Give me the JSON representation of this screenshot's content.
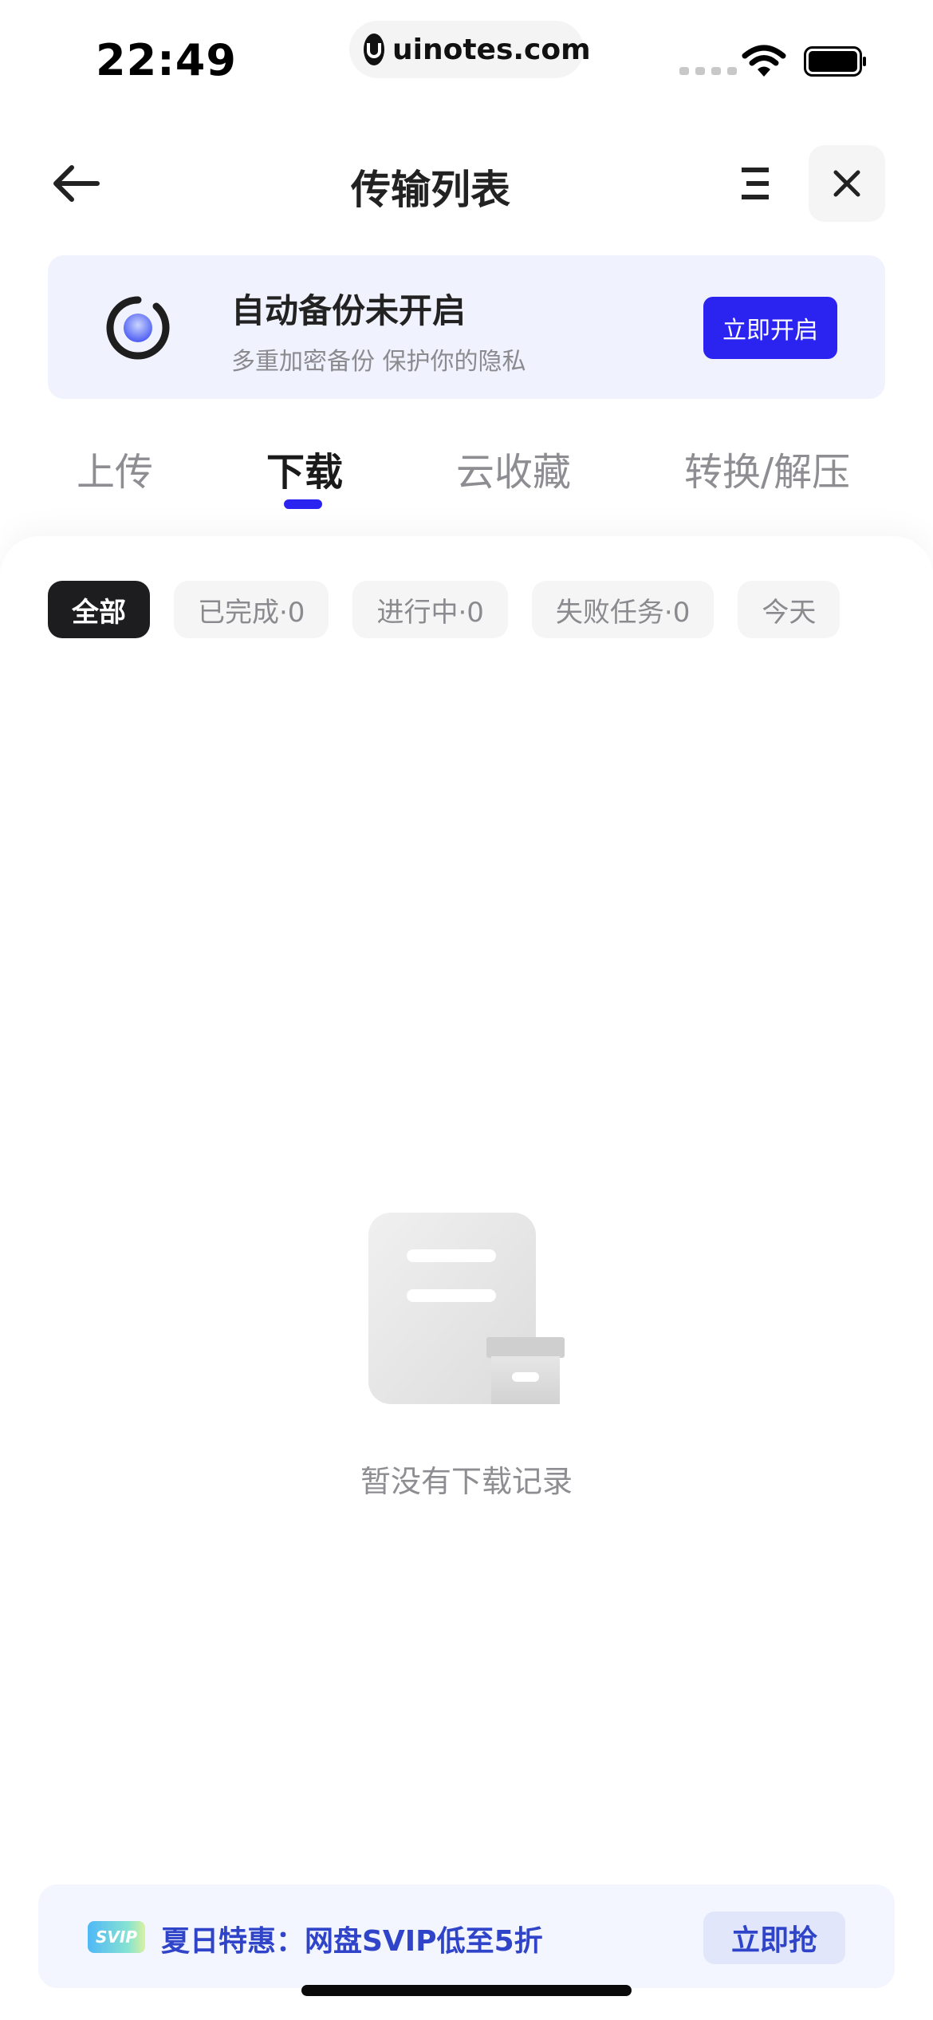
{
  "status_bar": {
    "time": "22:49",
    "url": "uinotes.com"
  },
  "header": {
    "title": "传输列表",
    "back_icon": "arrow-left-icon",
    "menu_icon": "list-menu-icon",
    "close_icon": "close-icon"
  },
  "banner": {
    "title": "自动备份未开启",
    "subtitle": "多重加密备份 保护你的隐私",
    "button_label": "立即开启"
  },
  "tabs": [
    {
      "label": "上传",
      "active": false
    },
    {
      "label": "下载",
      "active": true
    },
    {
      "label": "云收藏",
      "active": false
    },
    {
      "label": "转换/解压",
      "active": false
    }
  ],
  "filters": [
    {
      "label": "全部",
      "active": true
    },
    {
      "label": "已完成·0",
      "active": false
    },
    {
      "label": "进行中·0",
      "active": false
    },
    {
      "label": "失败任务·0",
      "active": false
    },
    {
      "label": "今天",
      "active": false
    }
  ],
  "empty_state": {
    "text": "暂没有下载记录"
  },
  "promo": {
    "badge": "SVIP",
    "text": "夏日特惠：网盘SVIP低至5折",
    "button_label": "立即抢"
  },
  "colors": {
    "accent": "#2b23f0",
    "promo_text": "#2f44c9",
    "banner_bg": "#f0f2fe"
  }
}
